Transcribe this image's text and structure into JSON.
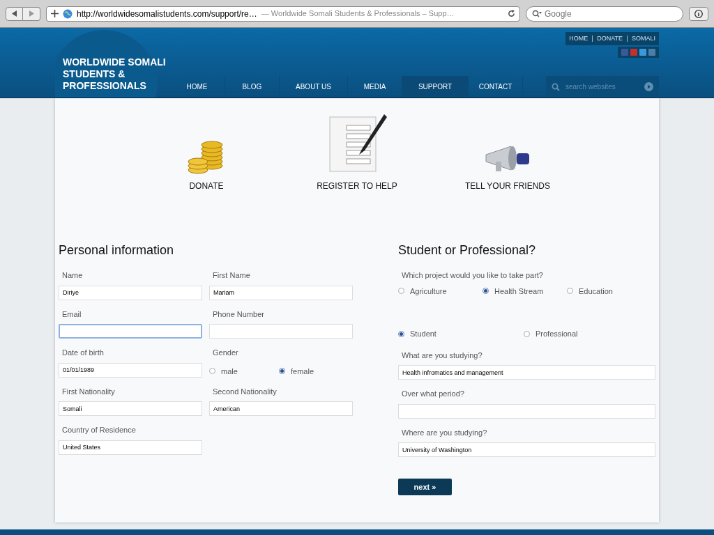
{
  "browser": {
    "url": "http://worldwidesomalistudents.com/support/re…",
    "page_title": "— Worldwide Somali Students & Professionals – Supp…",
    "search_placeholder": "Google"
  },
  "header": {
    "logo_lines": [
      "WORLDWIDE SOMALI",
      "STUDENTS &",
      "PROFESSIONALS"
    ],
    "top_links": [
      "HOME",
      "DONATE",
      "SOMALI"
    ],
    "nav": [
      {
        "label": "HOME",
        "selected": false
      },
      {
        "label": "BLOG",
        "selected": false
      },
      {
        "label": "ABOUT US",
        "selected": false
      },
      {
        "label": "MEDIA",
        "selected": false
      },
      {
        "label": "SUPPORT",
        "selected": true
      },
      {
        "label": "CONTACT",
        "selected": false
      }
    ],
    "search_placeholder": "search websites"
  },
  "actions": [
    {
      "kind": "coins",
      "label": "DONATE"
    },
    {
      "kind": "form",
      "label": "REGISTER TO HELP"
    },
    {
      "kind": "megaphone",
      "label": "TELL YOUR FRIENDS"
    }
  ],
  "personal": {
    "title": "Personal information",
    "rows": [
      [
        {
          "kind": "text",
          "label": "Name",
          "value": "Diriye",
          "focused": false
        },
        {
          "kind": "text",
          "label": "First Name",
          "value": "Mariam",
          "focused": false
        }
      ],
      [
        {
          "kind": "text",
          "label": "Email",
          "focused": true
        },
        {
          "kind": "text",
          "label": "Phone Number",
          "focused": false
        }
      ],
      [
        {
          "kind": "text",
          "label": "Date of birth",
          "value": "01/01/1989",
          "focused": false
        },
        {
          "kind": "radio",
          "label": "Gender",
          "options": [
            {
              "label": "male",
              "selected": false
            },
            {
              "label": "female",
              "selected": true
            }
          ]
        }
      ],
      [
        {
          "kind": "text",
          "label": "First Nationality",
          "value": "Somali",
          "focused": false
        },
        {
          "kind": "text",
          "label": "Second Nationality",
          "value": "American",
          "focused": false
        }
      ],
      [
        {
          "kind": "text",
          "label": "Country of Residence",
          "value": "United States",
          "focused": false
        }
      ]
    ]
  },
  "professional": {
    "title": "Student or Professional?",
    "project_question": "Which project would you like to take part?",
    "projects": [
      {
        "label": "Agriculture",
        "selected": false
      },
      {
        "label": "Health Stream",
        "selected": true
      },
      {
        "label": "Education",
        "selected": false
      }
    ],
    "roles": [
      {
        "label": "Student",
        "selected": true
      },
      {
        "label": "Professional",
        "selected": false
      }
    ],
    "fields": [
      {
        "label": "What are you studying?",
        "value": "Health infromatics and management"
      },
      {
        "label": "Over what period?"
      },
      {
        "label": "Where are you studying?",
        "value": "University of Washington"
      }
    ],
    "next_button": "next »"
  }
}
